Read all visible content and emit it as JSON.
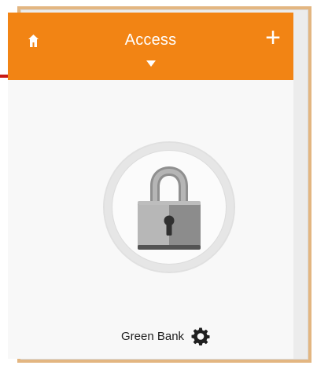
{
  "header": {
    "title": "Access",
    "home_icon": "home-icon",
    "add_icon": "plus-icon",
    "add_label": "+",
    "dropdown_icon": "chevron-down-icon",
    "accent_color": "#f28414"
  },
  "device": {
    "name": "Green Bank",
    "lock_icon": "padlock-icon",
    "settings_icon": "gear-icon"
  },
  "colors": {
    "frame_border": "#e3b681",
    "annotation_line": "#c91b14",
    "background": "#f8f8f8"
  }
}
